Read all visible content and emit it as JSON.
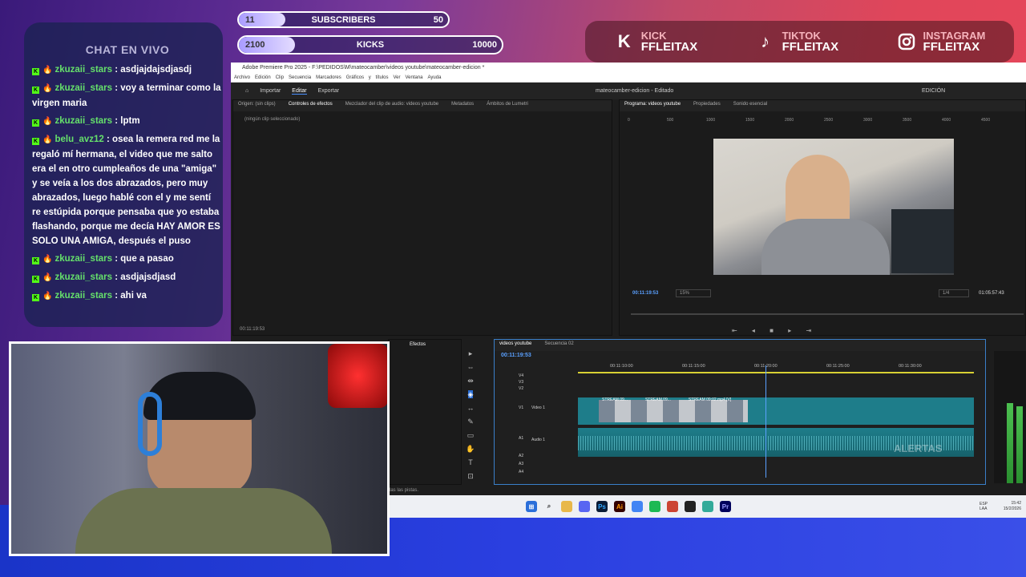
{
  "overlay": {
    "subs_bar": {
      "current": "11",
      "label": "SUBSCRIBERS",
      "goal": "50",
      "progress": 0.22
    },
    "kicks_bar": {
      "current": "2100",
      "label": "KICKS",
      "goal": "10000",
      "progress": 0.21
    },
    "chat": {
      "title": "CHAT EN VIVO",
      "messages": [
        {
          "user": "zkuzaii_stars",
          "text": " : asdjajdajsdjasdj"
        },
        {
          "user": "zkuzaii_stars",
          "text": " : voy a terminar como la virgen maria"
        },
        {
          "user": "zkuzaii_stars",
          "text": " : lptm"
        },
        {
          "user": "belu_avz12",
          "text": " : osea la remera red me la regaló mí hermana, el video que me salto era el en otro cumpleaños de una \"amiga\" y se veía a los dos abrazados, pero muy abrazados, luego hablé con el y me sentí re estúpida porque pensaba que yo estaba flashando, porque me decía HAY AMOR ES SOLO UNA AMIGA, después el puso"
        },
        {
          "user": "zkuzaii_stars",
          "text": " : que a pasao"
        },
        {
          "user": "zkuzaii_stars",
          "text": " : asdjajsdjasd"
        },
        {
          "user": "zkuzaii_stars",
          "text": " : ahi va"
        }
      ]
    },
    "socials": [
      {
        "platform": "KICK",
        "handle": "FFLEITAX",
        "icon": "kick-icon"
      },
      {
        "platform": "TIKTOK",
        "handle": "FFLEITAX",
        "icon": "tiktok-icon"
      },
      {
        "platform": "INSTAGRAM",
        "handle": "FFLEITAX",
        "icon": "instagram-icon"
      }
    ],
    "alerts_label": "ALERTAS"
  },
  "premiere": {
    "title": "Adobe Premiere Pro 2025 - F:\\PEDIDOS\\M\\mateocamber\\videos youtube\\mateocamber-edicion *",
    "menu": [
      "Archivo",
      "Edición",
      "Clip",
      "Secuencia",
      "Marcadores",
      "Gráficos y títulos",
      "Ver",
      "Ventana",
      "Ayuda"
    ],
    "workspace_tabs": [
      "Importar",
      "Editar",
      "Exportar"
    ],
    "project_title": "mateocamber-edicion - Editado",
    "edition_label": "EDICIÓN",
    "source_tabs": [
      "Origen: (sin clips)",
      "Controles de efectos",
      "Mezclador del clip de audio: videos youtube",
      "Metadatos",
      "Ámbitos de Lumetri"
    ],
    "no_clip": "(ningún clip seleccionado)",
    "source_time": "00:11:19:53",
    "program_tabs": [
      "Programa: videos youtube",
      "Propiedades",
      "Sonido esencial"
    ],
    "ruler_ticks": [
      "0",
      "500",
      "1000",
      "1500",
      "2000",
      "2500",
      "3000",
      "3500",
      "4000",
      "4500"
    ],
    "program_time": "00:11:19:53",
    "zoom": "15%",
    "quality": "1/4",
    "duration": "01:05:57:43",
    "effects_tab": "Efectos",
    "timeline_tabs": [
      "videos youtube",
      "Secuencia 02"
    ],
    "timeline_time": "00:11:19:53",
    "timecodes": [
      "00:11:10:00",
      "00:11:15:00",
      "00:11:20:00",
      "00:11:25:00",
      "00:11:30:00"
    ],
    "tracks": [
      "V4",
      "V3",
      "V2",
      "V1",
      "A1",
      "A2",
      "A3",
      "A4"
    ],
    "video_track_name": "Video 1",
    "audio_track_name": "Audio 1",
    "clips": [
      "STREAM 09...",
      "STREAM 09...",
      "STREAM 09:02.mp4 [V]"
    ],
    "status": "das las pistas.",
    "clock": "15:42",
    "date": "15/2/2026",
    "lang": "ESP LAA"
  }
}
